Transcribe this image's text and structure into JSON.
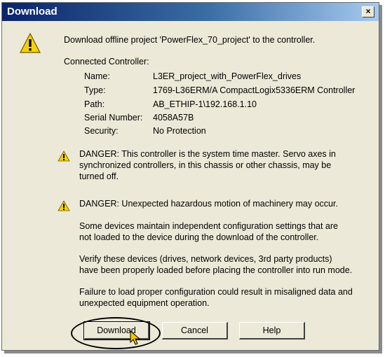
{
  "window": {
    "title": "Download",
    "close_label": "×"
  },
  "intro_text": "Download offline project 'PowerFlex_70_project' to the controller.",
  "connected_controller": {
    "heading": "Connected Controller:",
    "rows": [
      {
        "label": "Name:",
        "value": "L3ER_project_with_PowerFlex_drives"
      },
      {
        "label": "Type:",
        "value": "1769-L36ERM/A CompactLogix5336ERM Controller"
      },
      {
        "label": "Path:",
        "value": "AB_ETHIP-1\\192.168.1.10"
      },
      {
        "label": "Serial Number:",
        "value": "4058A57B"
      },
      {
        "label": "Security:",
        "value": "No Protection"
      }
    ]
  },
  "warnings": [
    {
      "lines": [
        "DANGER: This controller is the system time master.  Servo axes in",
        "synchronized controllers, in this chassis or other chassis, may be",
        "turned off."
      ]
    },
    {
      "lines": [
        "DANGER: Unexpected hazardous motion of machinery may occur."
      ]
    }
  ],
  "paragraphs": [
    {
      "lines": [
        "Some devices maintain independent configuration settings that are",
        "not loaded to the device during the download of the controller."
      ]
    },
    {
      "lines": [
        "Verify these devices (drives, network devices, 3rd party products)",
        "have been properly loaded before placing the controller into run mode."
      ]
    },
    {
      "lines": [
        "Failure to load proper configuration could result in misaligned data and",
        "unexpected equipment operation."
      ]
    }
  ],
  "buttons": {
    "download": "Download",
    "cancel": "Cancel",
    "help": "Help"
  },
  "icons": {
    "warning": "warning-icon",
    "cursor": "mouse-cursor-icon"
  },
  "colors": {
    "warning_yellow": "#f5d300",
    "title_bar": "#0a246a",
    "dialog_bg": "#ece9d8"
  }
}
